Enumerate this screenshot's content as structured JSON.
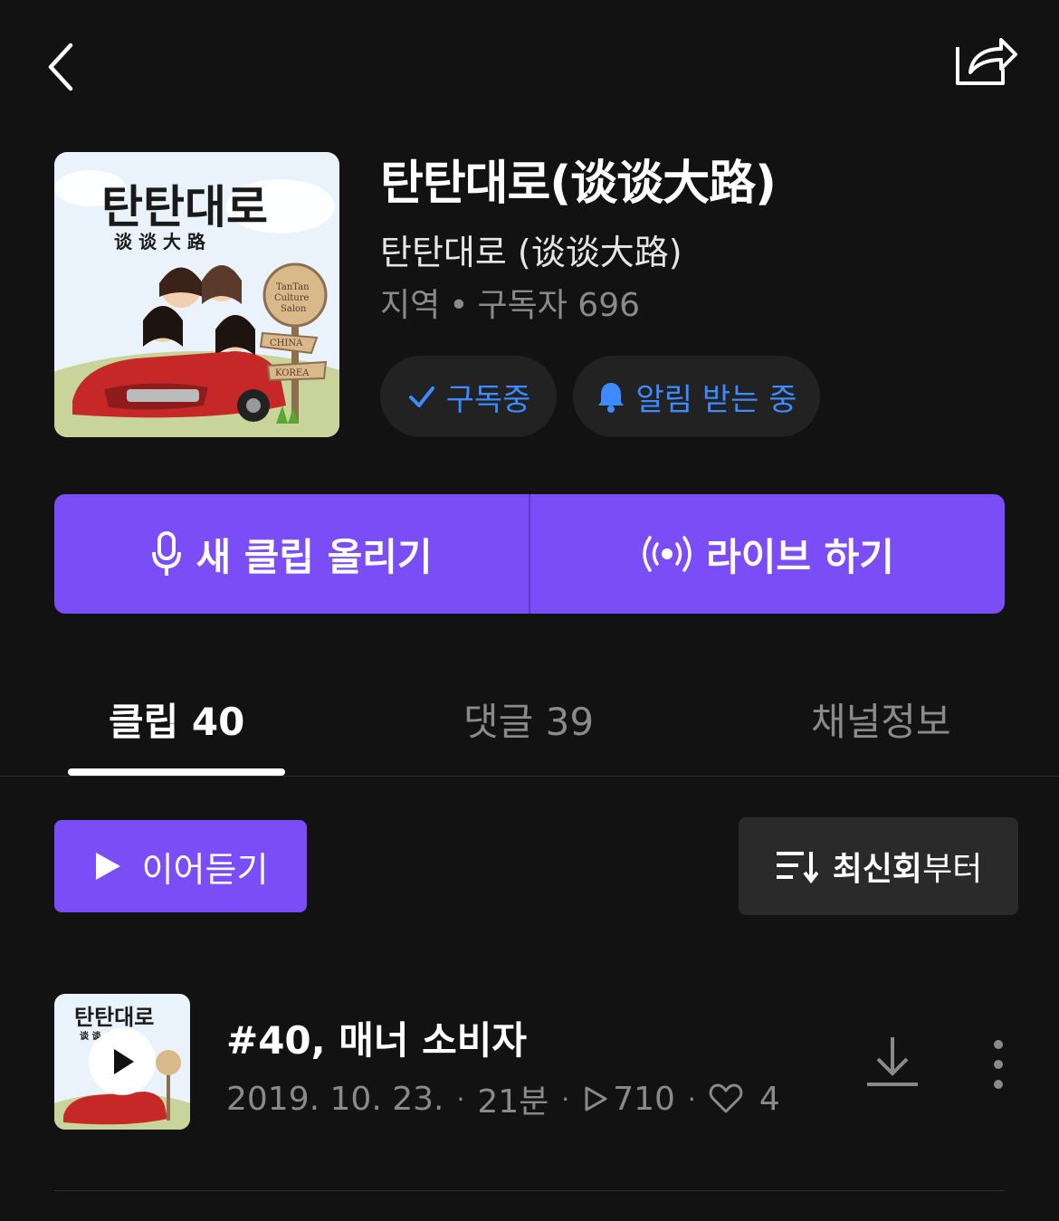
{
  "topbar": {
    "back_icon": "chevron-left-icon",
    "share_icon": "share-icon"
  },
  "channel": {
    "title": "탄탄대로(谈谈大路)",
    "subtitle": "탄탄대로 (谈谈大路)",
    "category": "지역",
    "subscribers": "구독자 696",
    "cover_text_kr": "탄탄대로",
    "cover_text_cn": "谈 谈 大 路",
    "cover_sign_lines": [
      "TanTan",
      "Culture",
      "Salon"
    ],
    "cover_sign_china": "CHINA",
    "cover_sign_korea": "KOREA"
  },
  "pills": {
    "subscribed": "구독중",
    "notify": "알림 받는 중"
  },
  "actions": {
    "new_clip": "새 클립 올리기",
    "live": "라이브 하기"
  },
  "tabs": [
    {
      "label": "클립 40",
      "active": true
    },
    {
      "label": "댓글 39",
      "active": false
    },
    {
      "label": "채널정보",
      "active": false
    }
  ],
  "controls": {
    "resume": "이어듣기",
    "sort_bold": "최신회",
    "sort_rest": "부터"
  },
  "episodes": [
    {
      "title": "#40, 매너 소비자",
      "date": "2019. 10. 23.",
      "duration": "21분",
      "plays": "710",
      "likes": "4",
      "thumb_text_kr": "탄탄대로",
      "thumb_text_cn": "谈 谈 大 路"
    }
  ],
  "colors": {
    "accent": "#7a4df7",
    "link_blue": "#3d8bff",
    "background": "#121212"
  }
}
